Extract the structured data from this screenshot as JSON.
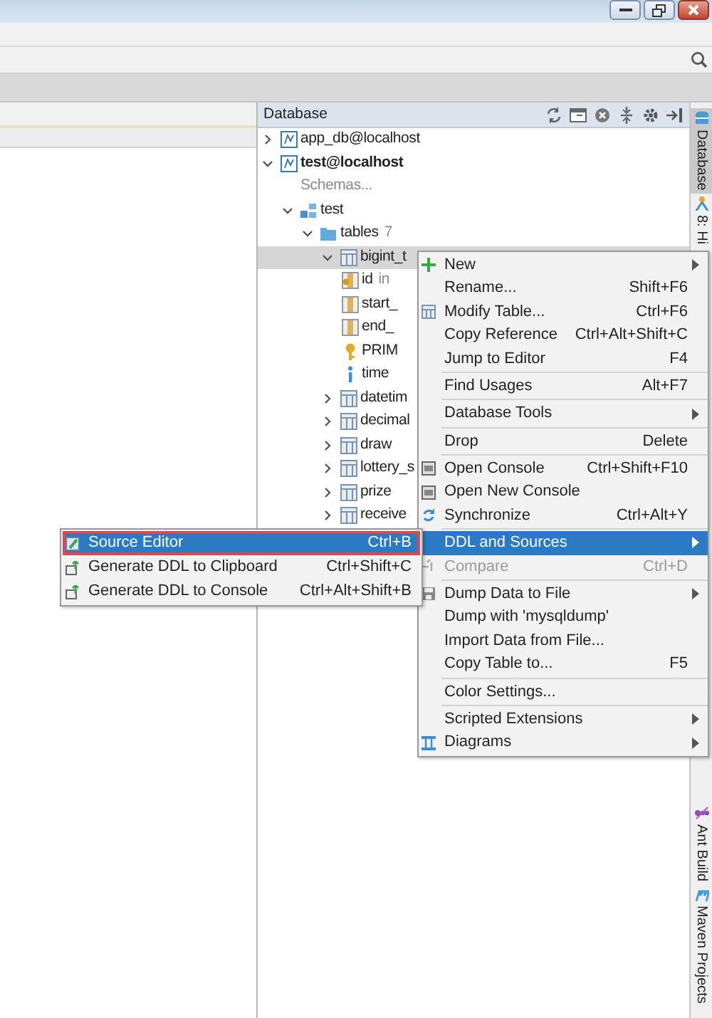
{
  "database_panel": {
    "title": "Database",
    "tree": [
      {
        "label": "app_db@localhost",
        "kind": "connection",
        "expanded": false,
        "bold": false
      },
      {
        "label": "test@localhost",
        "kind": "connection",
        "expanded": true,
        "bold": true,
        "children": [
          {
            "label": "Schemas...",
            "kind": "placeholder"
          },
          {
            "label": "test",
            "kind": "schema",
            "expanded": true,
            "children": [
              {
                "label": "tables",
                "count": "7",
                "kind": "folder",
                "expanded": true,
                "children": [
                  {
                    "label": "bigint_t",
                    "kind": "table",
                    "expanded": true,
                    "selected": true,
                    "children": [
                      {
                        "label": "id",
                        "type": "in",
                        "kind": "key-column"
                      },
                      {
                        "label": "start_",
                        "kind": "column"
                      },
                      {
                        "label": "end_",
                        "kind": "column"
                      },
                      {
                        "label": "PRIM",
                        "kind": "key"
                      },
                      {
                        "label": "time",
                        "kind": "index"
                      }
                    ]
                  },
                  {
                    "label": "datetim",
                    "kind": "table",
                    "expanded": false,
                    "selected": false
                  },
                  {
                    "label": "decimal",
                    "kind": "table",
                    "expanded": false,
                    "selected": false
                  },
                  {
                    "label": "draw",
                    "kind": "table",
                    "expanded": false,
                    "selected": false
                  },
                  {
                    "label": "lottery_s",
                    "kind": "table",
                    "expanded": false,
                    "selected": false
                  },
                  {
                    "label": "prize",
                    "kind": "table",
                    "expanded": false,
                    "selected": false
                  },
                  {
                    "label": "receive",
                    "kind": "table",
                    "expanded": false,
                    "selected": false
                  }
                ]
              }
            ]
          }
        ]
      }
    ]
  },
  "context_menu": {
    "items": [
      {
        "kind": "item",
        "label": "New",
        "submenu": true,
        "selected": false,
        "disabled": false
      },
      {
        "kind": "item",
        "label": "Rename...",
        "shortcut": "Shift+F6",
        "submenu": false,
        "selected": false,
        "disabled": false
      },
      {
        "kind": "item",
        "label": "Modify Table...",
        "shortcut": "Ctrl+F6",
        "submenu": false,
        "selected": false,
        "disabled": false
      },
      {
        "kind": "item",
        "label": "Copy Reference",
        "shortcut": "Ctrl+Alt+Shift+C",
        "submenu": false,
        "selected": false,
        "disabled": false
      },
      {
        "kind": "item",
        "label": "Jump to Editor",
        "shortcut": "F4",
        "submenu": false,
        "selected": false,
        "disabled": false
      },
      {
        "kind": "separator"
      },
      {
        "kind": "item",
        "label": "Find Usages",
        "shortcut": "Alt+F7",
        "submenu": false,
        "selected": false,
        "disabled": false
      },
      {
        "kind": "separator"
      },
      {
        "kind": "item",
        "label": "Database Tools",
        "submenu": true,
        "selected": false,
        "disabled": false
      },
      {
        "kind": "separator"
      },
      {
        "kind": "item",
        "label": "Drop",
        "shortcut": "Delete",
        "submenu": false,
        "selected": false,
        "disabled": false
      },
      {
        "kind": "separator"
      },
      {
        "kind": "item",
        "label": "Open Console",
        "shortcut": "Ctrl+Shift+F10",
        "submenu": false,
        "selected": false,
        "disabled": false
      },
      {
        "kind": "item",
        "label": "Open New Console",
        "submenu": false,
        "selected": false,
        "disabled": false
      },
      {
        "kind": "item",
        "label": "Synchronize",
        "shortcut": "Ctrl+Alt+Y",
        "submenu": false,
        "selected": false,
        "disabled": false
      },
      {
        "kind": "separator"
      },
      {
        "kind": "item",
        "label": "DDL and Sources",
        "submenu": true,
        "selected": true,
        "disabled": false
      },
      {
        "kind": "item",
        "label": "Compare",
        "shortcut": "Ctrl+D",
        "submenu": false,
        "selected": false,
        "disabled": true
      },
      {
        "kind": "separator"
      },
      {
        "kind": "item",
        "label": "Dump Data to File",
        "submenu": true,
        "selected": false,
        "disabled": false
      },
      {
        "kind": "item",
        "label": "Dump with 'mysqldump'",
        "submenu": false,
        "selected": false,
        "disabled": false
      },
      {
        "kind": "item",
        "label": "Import Data from File...",
        "submenu": false,
        "selected": false,
        "disabled": false
      },
      {
        "kind": "item",
        "label": "Copy Table to...",
        "shortcut": "F5",
        "submenu": false,
        "selected": false,
        "disabled": false
      },
      {
        "kind": "separator"
      },
      {
        "kind": "item",
        "label": "Color Settings...",
        "submenu": false,
        "selected": false,
        "disabled": false
      },
      {
        "kind": "separator"
      },
      {
        "kind": "item",
        "label": "Scripted Extensions",
        "submenu": true,
        "selected": false,
        "disabled": false
      },
      {
        "kind": "item",
        "label": "Diagrams",
        "submenu": true,
        "selected": false,
        "disabled": false
      }
    ]
  },
  "submenu": {
    "items": [
      {
        "label": "Source Editor",
        "shortcut": "Ctrl+B",
        "selected": true,
        "outlined": true
      },
      {
        "label": "Generate DDL to Clipboard",
        "shortcut": "Ctrl+Shift+C",
        "selected": false,
        "outlined": false
      },
      {
        "label": "Generate DDL to Console",
        "shortcut": "Ctrl+Alt+Shift+B",
        "selected": false,
        "outlined": false
      }
    ]
  },
  "side_tabs_top": [
    {
      "label": "Database",
      "selected": true
    },
    {
      "label": "8: Hi",
      "selected": false
    }
  ],
  "side_tabs_bottom": [
    {
      "label": "Ant Build",
      "selected": false
    },
    {
      "label": "Maven Projects",
      "selected": false
    }
  ]
}
